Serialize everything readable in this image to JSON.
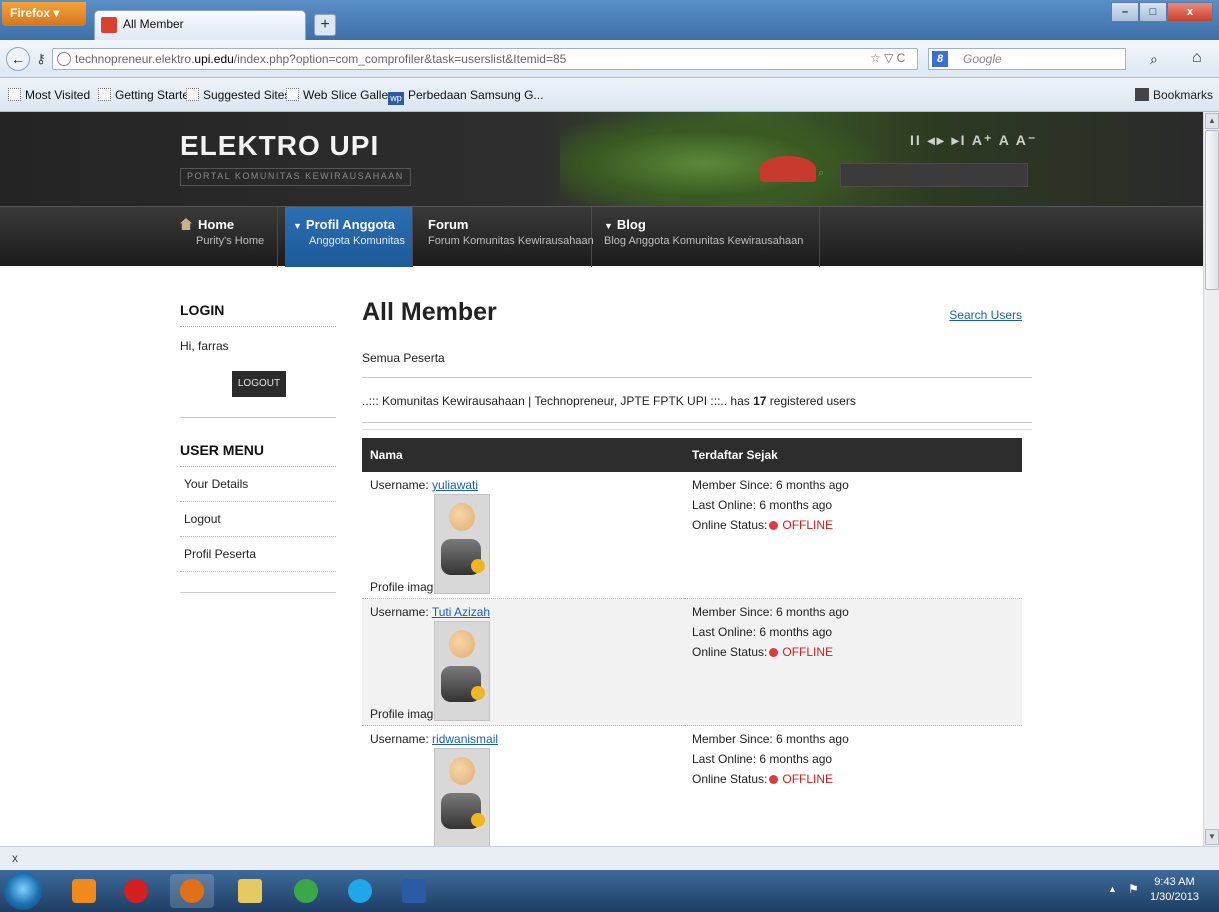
{
  "browser": {
    "menu_button": "Firefox",
    "tab_title": "All Member",
    "new_tab": "+",
    "url_prefix": "technopreneur.elektro.",
    "url_host": "upi.edu",
    "url_path": "/index.php?option=com_comprofiler&task=userslist&Itemid=85",
    "url_controls": "☆ ▽ C",
    "search_engine": "Google",
    "bookmarks": [
      {
        "label": "Most Visited"
      },
      {
        "label": "Getting Started"
      },
      {
        "label": "Suggested Sites"
      },
      {
        "label": "Web Slice Gallery"
      },
      {
        "label": "Perbedaan Samsung G..."
      }
    ],
    "bookmarks_menu": "Bookmarks"
  },
  "site": {
    "title": "ELEKTRO UPI",
    "tagline": "PORTAL KOMUNITAS KEWIRAUSAHAAN",
    "controls": "II ◂▸ ▸I  A⁺ A A⁻",
    "menu": [
      {
        "title": "Home",
        "sub": "Purity's Home"
      },
      {
        "title": "Profil Anggota",
        "sub": "Anggota Komunitas"
      },
      {
        "title": "Forum",
        "sub": "Forum Komunitas Kewirausahaan"
      },
      {
        "title": "Blog",
        "sub": "Blog Anggota Komunitas Kewirausahaan"
      }
    ]
  },
  "sidebar": {
    "login_heading": "LOGIN",
    "greeting": "Hi, farras",
    "logout_button": "LOGOUT",
    "usermenu_heading": "USER MENU",
    "links": [
      {
        "label": "Your Details"
      },
      {
        "label": "Logout"
      },
      {
        "label": "Profil Peserta"
      }
    ]
  },
  "content": {
    "heading": "All Member",
    "search_users": "Search Users",
    "subtitle": "Semua Peserta",
    "reg_prefix": "..::: Komunitas Kewirausahaan | Technopreneur, JPTE FPTK UPI :::.. has",
    "reg_count": "17",
    "reg_suffix": "registered users",
    "table": {
      "col_name": "Nama",
      "col_since": "Terdaftar Sejak",
      "username_label": "Username:",
      "profile_image_label": "Profile image:",
      "member_since_label": "Member Since:",
      "last_online_label": "Last Online:",
      "online_status_label": "Online Status:",
      "rows": [
        {
          "username": "yuliawati",
          "member_since": "6 months ago",
          "last_online": "6 months ago",
          "status": "OFFLINE"
        },
        {
          "username": "Tuti Azizah",
          "member_since": "6 months ago",
          "last_online": "6 months ago",
          "status": "OFFLINE"
        },
        {
          "username": "ridwanismail",
          "member_since": "6 months ago",
          "last_online": "6 months ago",
          "status": "OFFLINE"
        }
      ]
    }
  },
  "findbar": {
    "close": "x"
  },
  "taskbar": {
    "time": "9:43 AM",
    "date": "1/30/2013",
    "apps": [
      {
        "name": "media-player-icon",
        "color": "#f08a1c"
      },
      {
        "name": "opera-icon",
        "color": "#d62020"
      },
      {
        "name": "firefox-icon",
        "color": "#e0701a"
      },
      {
        "name": "file-explorer-icon",
        "color": "#e8c860"
      },
      {
        "name": "chrome-icon",
        "color": "#3aa84a"
      },
      {
        "name": "skype-icon",
        "color": "#1fa7e8"
      },
      {
        "name": "word-icon",
        "color": "#2b5aa6"
      }
    ]
  }
}
